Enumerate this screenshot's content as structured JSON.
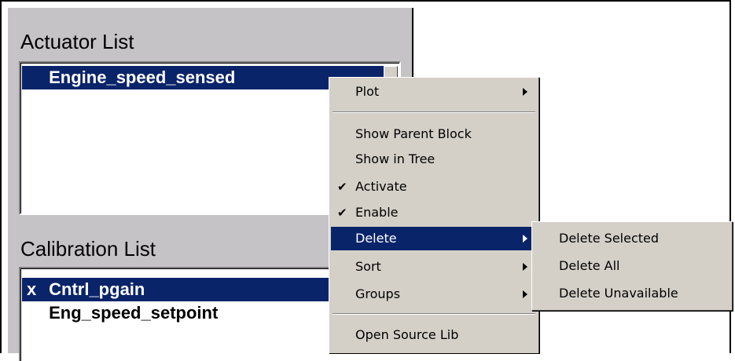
{
  "actuator_list": {
    "title": "Actuator List",
    "items": [
      {
        "mark": "",
        "label": "Engine_speed_sensed",
        "selected": true
      }
    ]
  },
  "calibration_list": {
    "title": "Calibration List",
    "items": [
      {
        "mark": "x",
        "label": "Cntrl_pgain",
        "selected": true
      },
      {
        "mark": "",
        "label": "Eng_speed_setpoint",
        "selected": false
      }
    ]
  },
  "context_menu": {
    "items": [
      {
        "label": "Plot",
        "has_submenu": true,
        "checked": false
      },
      {
        "label": "Show Parent Block",
        "has_submenu": false,
        "checked": false
      },
      {
        "label": "Show in Tree",
        "has_submenu": false,
        "checked": false
      },
      {
        "label": "Activate",
        "has_submenu": false,
        "checked": true
      },
      {
        "label": "Enable",
        "has_submenu": false,
        "checked": true
      },
      {
        "label": "Delete",
        "has_submenu": true,
        "checked": false,
        "highlighted": true
      },
      {
        "label": "Sort",
        "has_submenu": true,
        "checked": false
      },
      {
        "label": "Groups",
        "has_submenu": true,
        "checked": false
      },
      {
        "label": "Open Source Lib",
        "has_submenu": false,
        "checked": false
      }
    ],
    "check_glyph": "✔"
  },
  "delete_submenu": {
    "items": [
      {
        "label": "Delete Selected"
      },
      {
        "label": "Delete All"
      },
      {
        "label": "Delete Unavailable"
      }
    ]
  },
  "colors": {
    "pane_background": "#c6c3c6",
    "menu_background": "#d4d0c8",
    "selection": "#0a246a"
  }
}
